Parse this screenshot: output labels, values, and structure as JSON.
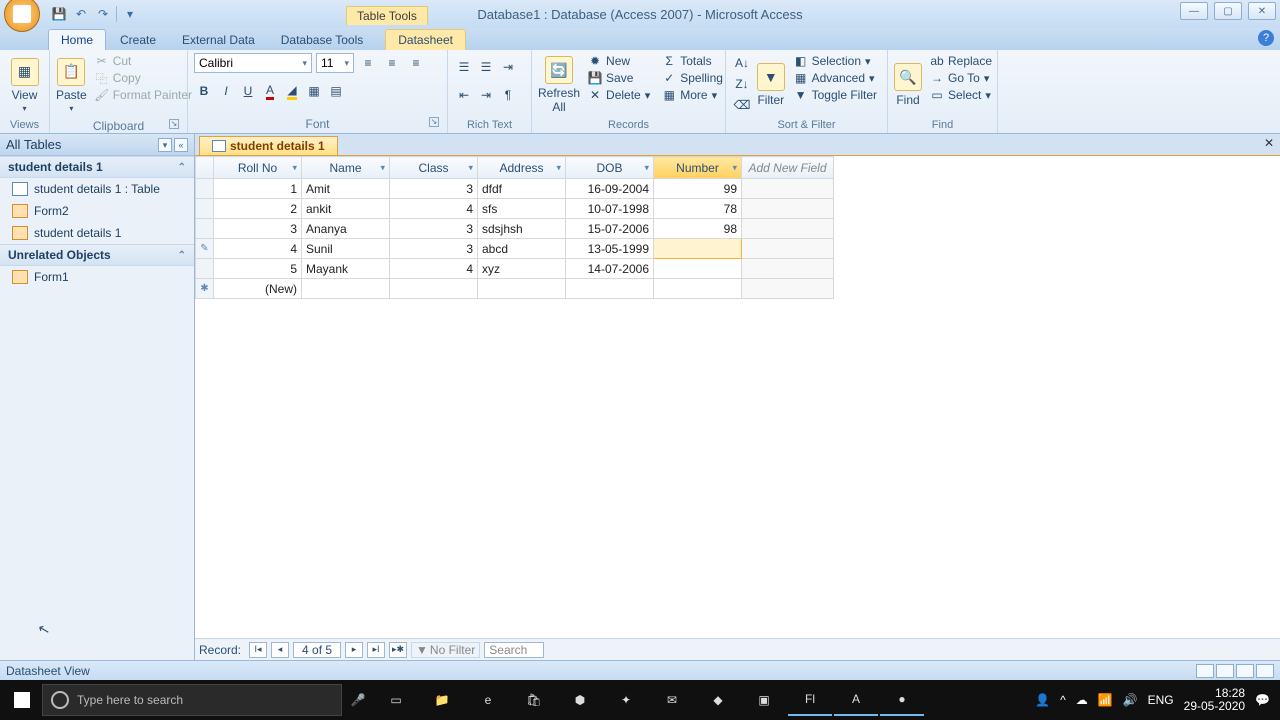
{
  "app": {
    "title": "Database1 : Database (Access 2007) - Microsoft Access",
    "table_tools": "Table Tools"
  },
  "tabs": {
    "home": "Home",
    "create": "Create",
    "external": "External Data",
    "dbtools": "Database Tools",
    "datasheet": "Datasheet"
  },
  "ribbon": {
    "views": {
      "label": "Views",
      "view": "View"
    },
    "clipboard": {
      "label": "Clipboard",
      "paste": "Paste",
      "cut": "Cut",
      "copy": "Copy",
      "format_painter": "Format Painter"
    },
    "font": {
      "label": "Font",
      "name": "Calibri",
      "size": "11"
    },
    "richtext": {
      "label": "Rich Text"
    },
    "records": {
      "label": "Records",
      "refresh": "Refresh All",
      "new": "New",
      "save": "Save",
      "delete": "Delete",
      "totals": "Totals",
      "spelling": "Spelling",
      "more": "More"
    },
    "sortfilter": {
      "label": "Sort & Filter",
      "filter": "Filter",
      "selection": "Selection",
      "advanced": "Advanced",
      "toggle": "Toggle Filter"
    },
    "find": {
      "label": "Find",
      "find": "Find",
      "replace": "Replace",
      "goto": "Go To",
      "select": "Select"
    }
  },
  "navpane": {
    "header": "All Tables",
    "group1": {
      "title": "student details 1",
      "items": [
        "student details 1 : Table",
        "Form2",
        "student details 1"
      ]
    },
    "group2": {
      "title": "Unrelated Objects",
      "items": [
        "Form1"
      ]
    }
  },
  "doc_tab": "student details 1",
  "columns": [
    "Roll No",
    "Name",
    "Class",
    "Address",
    "DOB",
    "Number",
    "Add New Field"
  ],
  "rows": [
    {
      "roll": "1",
      "name": "Amit",
      "class": "3",
      "address": "dfdf",
      "dob": "16-09-2004",
      "number": "99"
    },
    {
      "roll": "2",
      "name": "ankit",
      "class": "4",
      "address": "sfs",
      "dob": "10-07-1998",
      "number": "78"
    },
    {
      "roll": "3",
      "name": "Ananya",
      "class": "3",
      "address": "sdsjhsh",
      "dob": "15-07-2006",
      "number": "98"
    },
    {
      "roll": "4",
      "name": "Sunil",
      "class": "3",
      "address": "abcd",
      "dob": "13-05-1999",
      "number": ""
    },
    {
      "roll": "5",
      "name": "Mayank",
      "class": "4",
      "address": "xyz",
      "dob": "14-07-2006",
      "number": ""
    }
  ],
  "new_row": "(New)",
  "recnav": {
    "label": "Record:",
    "pos": "4 of 5",
    "nofilter": "No Filter",
    "search": "Search"
  },
  "statusbar": {
    "text": "Datasheet View"
  },
  "taskbar": {
    "search_placeholder": "Type here to search",
    "lang": "ENG",
    "time": "18:28",
    "date": "29-05-2020"
  }
}
